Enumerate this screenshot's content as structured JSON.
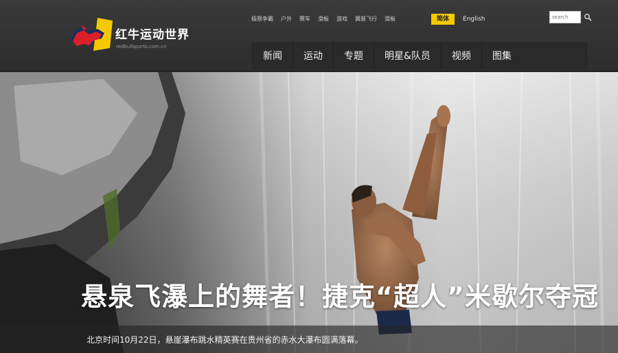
{
  "brand": {
    "name": "红牛运动世界",
    "url": "redbullsports.com.cn",
    "colors": {
      "red": "#d9202b",
      "yellow": "#f5c800",
      "blue": "#1b2d63"
    }
  },
  "top_links": [
    {
      "label": "极限争霸"
    },
    {
      "label": "户外"
    },
    {
      "label": "赛车"
    },
    {
      "label": "滑板"
    },
    {
      "label": "游戏"
    },
    {
      "label": "翼装飞行"
    },
    {
      "label": "滑板"
    }
  ],
  "language": {
    "options": [
      {
        "label": "简体",
        "active": true
      },
      {
        "label": "English",
        "active": false
      }
    ]
  },
  "search": {
    "placeholder": "search",
    "icon": "search-icon"
  },
  "main_nav": [
    {
      "label": "新闻"
    },
    {
      "label": "运动"
    },
    {
      "label": "专题"
    },
    {
      "label": "明星&队员"
    },
    {
      "label": "视频"
    },
    {
      "label": "图集"
    }
  ],
  "hero": {
    "title": "悬泉飞瀑上的舞者！捷克“超人”米歇尔夺冠",
    "caption": "北京时间10月22日，悬崖瀑布跳水精英赛在贵州省的赤水大瀑布圆满落幕。"
  }
}
